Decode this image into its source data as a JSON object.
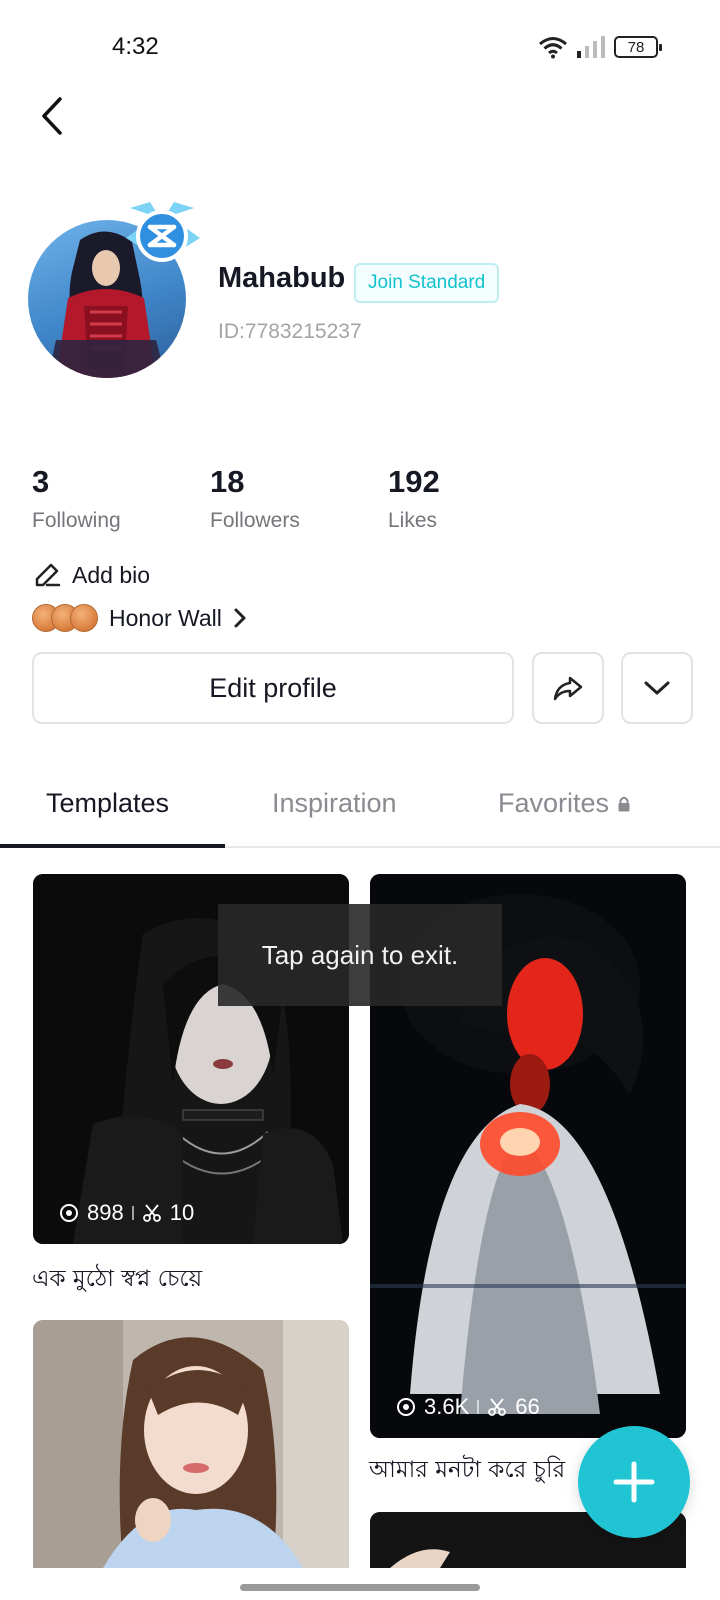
{
  "status_bar": {
    "time": "4:32",
    "battery": "78"
  },
  "profile": {
    "username": "Mahabub",
    "badge_label": "Join Standard",
    "user_id": "ID:7783215237"
  },
  "stats": [
    {
      "value": "3",
      "label": "Following"
    },
    {
      "value": "18",
      "label": "Followers"
    },
    {
      "value": "192",
      "label": "Likes"
    }
  ],
  "bio": {
    "label": "Add bio"
  },
  "honor_wall": {
    "label": "Honor Wall"
  },
  "actions": {
    "edit_profile": "Edit profile"
  },
  "tabs": [
    {
      "label": "Templates",
      "active": true
    },
    {
      "label": "Inspiration",
      "active": false
    },
    {
      "label": "Favorites",
      "active": false,
      "locked": true
    }
  ],
  "templates": [
    {
      "views": "898",
      "uses": "10",
      "caption": "এক মুঠো স্বপ্ন চেয়ে"
    },
    {
      "views": "3.6K",
      "uses": "66",
      "caption": "আমার মনটা করে চুরি"
    }
  ],
  "toast": "Tap again to exit.",
  "colors": {
    "accent": "#20c4d3",
    "badge_text": "#13c2cf",
    "text": "#161823",
    "muted": "#75767b"
  }
}
